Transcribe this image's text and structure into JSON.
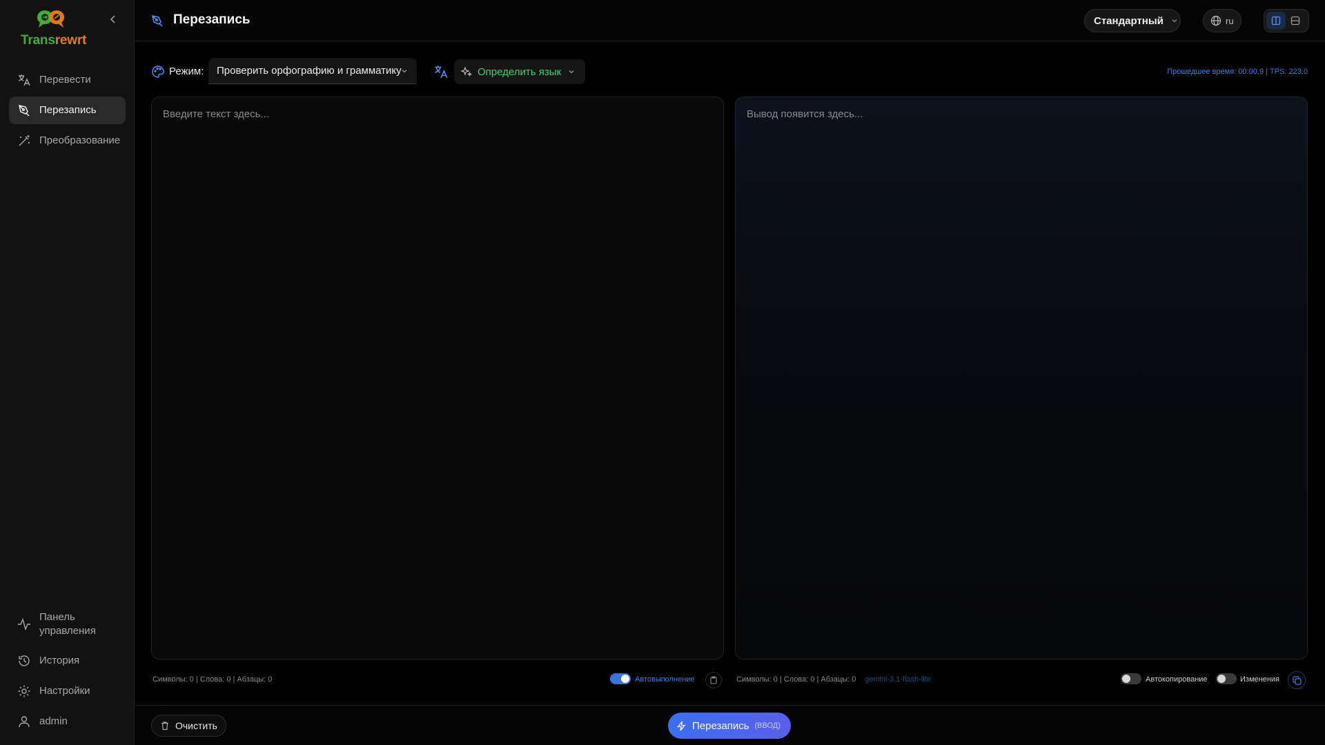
{
  "app": {
    "logo_part1": "Trans",
    "logo_part2": "rewrt"
  },
  "sidebar": {
    "items": [
      {
        "label": "Перевести",
        "icon": "translate-icon"
      },
      {
        "label": "Перезапись",
        "icon": "pen-nib-icon",
        "active": true
      },
      {
        "label": "Преобразование",
        "icon": "magic-wand-icon"
      }
    ],
    "bottom_items": [
      {
        "label": "Панель управления",
        "icon": "activity-icon"
      },
      {
        "label": "История",
        "icon": "history-icon"
      },
      {
        "label": "Настройки",
        "icon": "gear-icon"
      },
      {
        "label": "admin",
        "icon": "user-icon"
      }
    ]
  },
  "header": {
    "title": "Перезапись",
    "preset": "Стандартный",
    "language": "ru"
  },
  "toolbar": {
    "mode_label": "Режим:",
    "mode_value": "Проверить орфографию и грамматику",
    "detect_language": "Определить язык",
    "elapsed": "Прошедшее время: 00:00,9 | TPS: 223,0"
  },
  "input": {
    "placeholder": "Введите текст здесь...",
    "stats": "Символы: 0 | Слова: 0 | Абзацы: 0",
    "autorun_label": "Автовыполнение",
    "autorun_on": true
  },
  "output": {
    "placeholder": "Вывод появится здесь...",
    "stats": "Символы: 0 | Слова: 0 | Абзацы: 0",
    "model": "gemini-3.1-flash-lite",
    "autocopy_label": "Автокопирование",
    "autocopy_on": false,
    "changes_label": "Изменения",
    "changes_on": false
  },
  "footer": {
    "clear_label": "Очистить",
    "run_label": "Перезапись",
    "run_shortcut": "(ВВОД)"
  },
  "colors": {
    "accent": "#3b6ff0",
    "detect": "#3fcf6f"
  }
}
